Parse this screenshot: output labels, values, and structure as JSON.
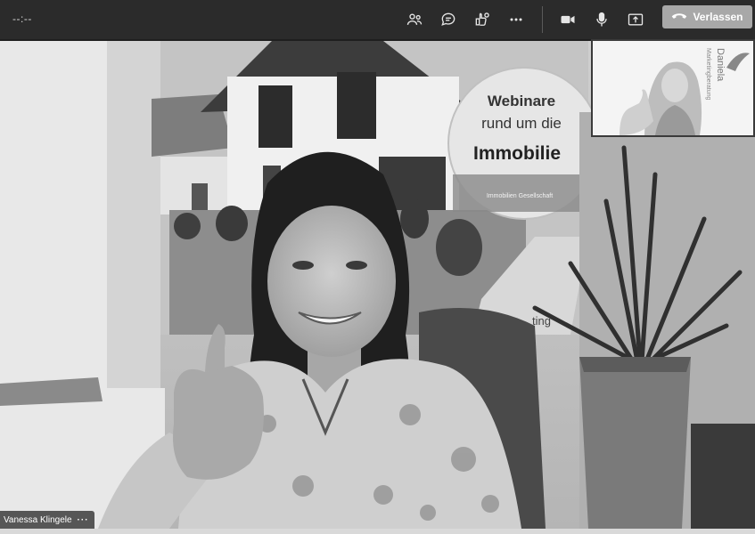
{
  "meeting": {
    "timer": "--:--"
  },
  "toolbar": {
    "icons": {
      "participants": "people-icon",
      "chat": "chat-icon",
      "reactions": "reaction-icon",
      "more": "more-icon",
      "camera": "camera-icon",
      "mic": "mic-icon",
      "share": "share-icon"
    },
    "leave_label": "Verlassen"
  },
  "colors": {
    "topbar": "#2b2b2b",
    "leave_button": "#a8a8a8"
  },
  "main_video": {
    "participant_name": "Vanessa Klingele",
    "name_more": "···",
    "sign": {
      "line1": "Webinare",
      "line2": "rund um die",
      "line3": "Immobilie",
      "badge": "Immobilien Gesellschaft"
    },
    "partial_text": "ting"
  },
  "pip_video": {
    "logo_line1": "Daniela",
    "logo_line2": "Marketingberatung"
  }
}
